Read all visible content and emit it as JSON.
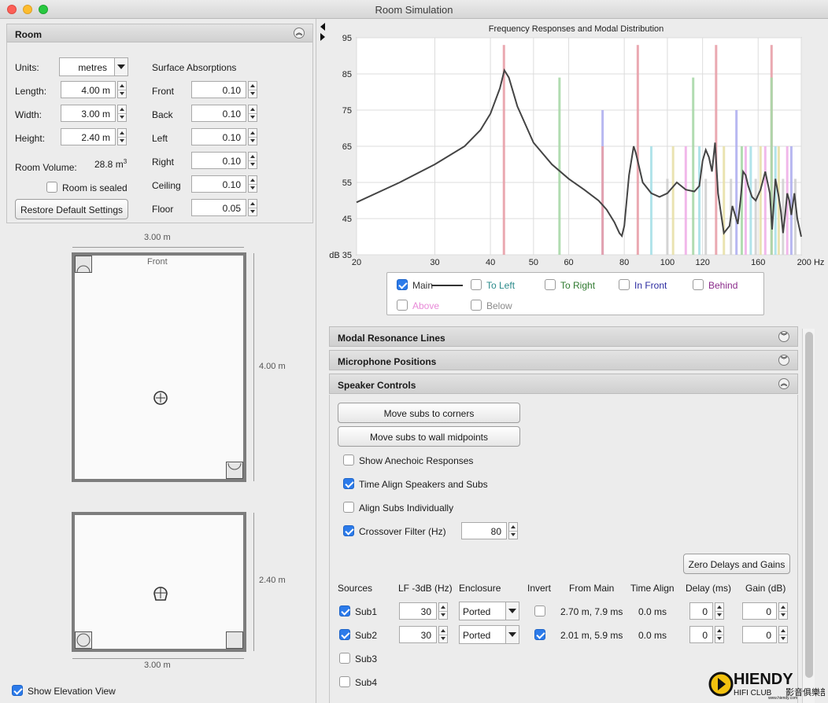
{
  "window": {
    "title": "Room Simulation"
  },
  "room_panel": {
    "title": "Room",
    "units_label": "Units:",
    "units_value": "metres",
    "length_label": "Length:",
    "length_value": "4.00 m",
    "width_label": "Width:",
    "width_value": "3.00 m",
    "height_label": "Height:",
    "height_value": "2.40 m",
    "volume_label": "Room Volume:",
    "volume_value": "28.8 m",
    "volume_sup": "3",
    "sealed_label": "Room is sealed",
    "sealed_checked": false,
    "restore_button": "Restore Default Settings",
    "absorptions_title": "Surface Absorptions",
    "surfaces": [
      {
        "label": "Front",
        "value": "0.10"
      },
      {
        "label": "Back",
        "value": "0.10"
      },
      {
        "label": "Left",
        "value": "0.10"
      },
      {
        "label": "Right",
        "value": "0.10"
      },
      {
        "label": "Ceiling",
        "value": "0.10"
      },
      {
        "label": "Floor",
        "value": "0.05"
      }
    ]
  },
  "plan_view": {
    "width_dim": "3.00 m",
    "length_dim": "4.00 m",
    "front_label": "Front"
  },
  "elevation_view": {
    "height_dim": "2.40 m",
    "width_dim": "3.00 m",
    "show_label": "Show Elevation View",
    "show_checked": true
  },
  "chart_data": {
    "type": "line",
    "title": "Frequency Responses and Modal Distribution",
    "xlabel": "Hz",
    "ylabel": "dB",
    "x_scale": "log",
    "xlim": [
      20,
      200
    ],
    "ylim": [
      35,
      95
    ],
    "x_ticks": [
      20,
      30,
      40,
      50,
      60,
      80,
      100,
      120,
      160,
      200
    ],
    "x_tick_labels": [
      "20",
      "30",
      "40",
      "50",
      "60",
      "80",
      "100",
      "120",
      "160",
      "200 Hz"
    ],
    "y_ticks": [
      35,
      45,
      55,
      65,
      75,
      85,
      95
    ],
    "y_tick_labels": [
      "dB 35",
      "45",
      "55",
      "65",
      "75",
      "85",
      "95"
    ],
    "grid": true,
    "series": [
      {
        "name": "Main",
        "x": [
          20,
          25,
          30,
          35,
          38,
          40,
          42,
          43,
          44,
          46,
          50,
          55,
          60,
          65,
          70,
          73,
          76,
          78,
          79,
          80,
          82,
          84,
          85,
          88,
          92,
          96,
          100,
          105,
          110,
          115,
          118,
          120,
          122,
          124,
          126,
          128,
          130,
          134,
          138,
          140,
          142,
          144,
          146,
          148,
          150,
          152,
          155,
          158,
          162,
          166,
          170,
          172,
          175,
          178,
          180,
          182,
          184,
          186,
          188,
          190,
          193,
          196,
          200
        ],
        "y": [
          49.5,
          55,
          60,
          65,
          69.5,
          74,
          81,
          86,
          84,
          76,
          66,
          60,
          56,
          53,
          50,
          47.5,
          44,
          41,
          40.2,
          43,
          57,
          65,
          63,
          55,
          52,
          51,
          52,
          55,
          53,
          52.5,
          54,
          61,
          64,
          62,
          58,
          66,
          52,
          41,
          43,
          48.5,
          46,
          43.5,
          50,
          58,
          57,
          54,
          51,
          50,
          53,
          58,
          52,
          42,
          56,
          51,
          47,
          41,
          46,
          52,
          50,
          46,
          52,
          45,
          40
        ]
      }
    ],
    "modal_lines": [
      {
        "freq": 42.9,
        "level": 93,
        "color": "#e8a0a8"
      },
      {
        "freq": 57.2,
        "level": 84,
        "color": "#a8d8a8"
      },
      {
        "freq": 71.5,
        "level": 75,
        "color": "#b0b0f0"
      },
      {
        "freq": 71.5,
        "level": 65,
        "color": "#e8a0a8"
      },
      {
        "freq": 85.8,
        "level": 93,
        "color": "#e8a0a8"
      },
      {
        "freq": 92.0,
        "level": 65,
        "color": "#a8e0e8"
      },
      {
        "freq": 100.0,
        "level": 56,
        "color": "#d0d0d0"
      },
      {
        "freq": 103.0,
        "level": 65,
        "color": "#e8e0a8"
      },
      {
        "freq": 110.0,
        "level": 65,
        "color": "#f0b0e8"
      },
      {
        "freq": 114.3,
        "level": 84,
        "color": "#a8d8a8"
      },
      {
        "freq": 118.0,
        "level": 65,
        "color": "#a8e0e8"
      },
      {
        "freq": 122.0,
        "level": 56,
        "color": "#d0d0d0"
      },
      {
        "freq": 128.7,
        "level": 93,
        "color": "#e8a0a8"
      },
      {
        "freq": 134.0,
        "level": 65,
        "color": "#e8e0a8"
      },
      {
        "freq": 139.0,
        "level": 56,
        "color": "#d0d0d0"
      },
      {
        "freq": 143.0,
        "level": 75,
        "color": "#b0b0f0"
      },
      {
        "freq": 147.0,
        "level": 65,
        "color": "#a8d8a8"
      },
      {
        "freq": 150.0,
        "level": 65,
        "color": "#f0b0e8"
      },
      {
        "freq": 154.0,
        "level": 65,
        "color": "#a8e0e8"
      },
      {
        "freq": 158.0,
        "level": 56,
        "color": "#d0d0d0"
      },
      {
        "freq": 162.0,
        "level": 65,
        "color": "#e8e0a8"
      },
      {
        "freq": 166.0,
        "level": 65,
        "color": "#f0b0e8"
      },
      {
        "freq": 171.5,
        "level": 93,
        "color": "#e8a0a8"
      },
      {
        "freq": 171.5,
        "level": 84,
        "color": "#a8d8a8"
      },
      {
        "freq": 175.0,
        "level": 65,
        "color": "#a8e0e8"
      },
      {
        "freq": 178.0,
        "level": 65,
        "color": "#e8e0a8"
      },
      {
        "freq": 182.0,
        "level": 56,
        "color": "#d0d0d0"
      },
      {
        "freq": 186.0,
        "level": 65,
        "color": "#f0b0e8"
      },
      {
        "freq": 190.0,
        "level": 65,
        "color": "#b0b0f0"
      },
      {
        "freq": 194.0,
        "level": 56,
        "color": "#d0d0d0"
      }
    ],
    "legend": [
      {
        "name": "Main",
        "checked": true,
        "color": "#333333"
      },
      {
        "name": "To Left",
        "checked": false,
        "color": "#2a8a8a"
      },
      {
        "name": "To Right",
        "checked": false,
        "color": "#2f7a2f"
      },
      {
        "name": "In Front",
        "checked": false,
        "color": "#2a2aa0"
      },
      {
        "name": "Behind",
        "checked": false,
        "color": "#8a2a8a"
      },
      {
        "name": "Above",
        "checked": false,
        "color": "#e88ad8"
      },
      {
        "name": "Below",
        "checked": false,
        "color": "#8a8a8a"
      }
    ]
  },
  "sections": {
    "modal": "Modal Resonance Lines",
    "mic": "Microphone Positions",
    "speaker": "Speaker Controls"
  },
  "speaker_controls": {
    "move_corners": "Move subs to corners",
    "move_midpoints": "Move subs to wall midpoints",
    "show_anechoic": "Show Anechoic Responses",
    "show_anechoic_checked": false,
    "time_align": "Time Align Speakers and Subs",
    "time_align_checked": true,
    "align_individually": "Align Subs Individually",
    "align_individually_checked": false,
    "crossover_label": "Crossover Filter (Hz)",
    "crossover_checked": true,
    "crossover_value": "80",
    "zero_button": "Zero Delays and Gains",
    "headers": {
      "sources": "Sources",
      "lf": "LF -3dB (Hz)",
      "enclosure": "Enclosure",
      "invert": "Invert",
      "from_main": "From Main",
      "time_align": "Time Align",
      "delay": "Delay (ms)",
      "gain": "Gain (dB)"
    },
    "sources": [
      {
        "name": "Sub1",
        "checked": true,
        "lf": "30",
        "enclosure": "Ported",
        "invert": false,
        "from_main": "2.70 m, 7.9 ms",
        "time_align": "0.0 ms",
        "delay": "0",
        "gain": "0"
      },
      {
        "name": "Sub2",
        "checked": true,
        "lf": "30",
        "enclosure": "Ported",
        "invert": true,
        "from_main": "2.01 m, 5.9 ms",
        "time_align": "0.0 ms",
        "delay": "0",
        "gain": "0"
      },
      {
        "name": "Sub3",
        "checked": false
      },
      {
        "name": "Sub4",
        "checked": false
      }
    ]
  },
  "watermark": {
    "brand": "HIENDY",
    "sub": "HIFI CLUB",
    "url": "www.hiendy.com",
    "chinese": "影音俱樂部"
  }
}
